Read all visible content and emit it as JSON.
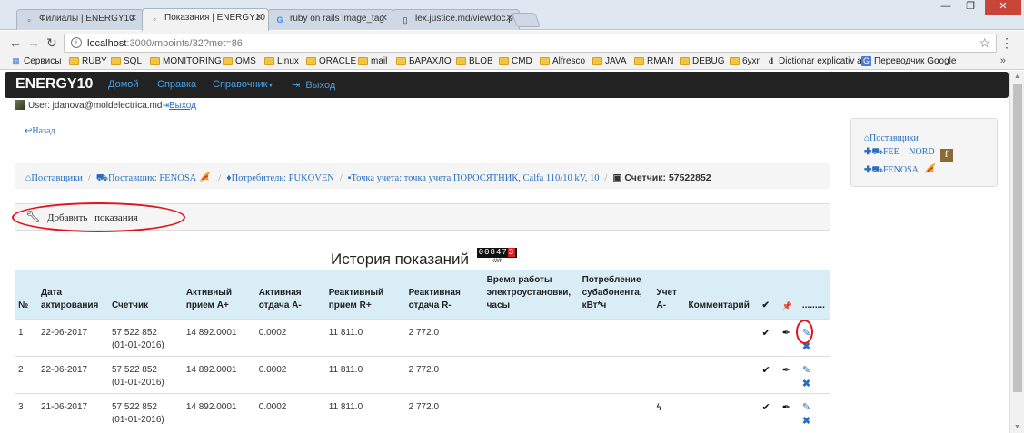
{
  "browser": {
    "tabs": [
      {
        "title": "Филиалы | ENERGY10",
        "favicon": "page-icon"
      },
      {
        "title": "Показания | ENERGY10",
        "favicon": "page-icon"
      },
      {
        "title": "ruby on rails image_tag",
        "favicon": "google-icon"
      },
      {
        "title": "lex.justice.md/viewdoc.p",
        "favicon": "document-icon"
      }
    ],
    "window_controls": {
      "minimize": "—",
      "maximize": "❐",
      "close": "✕"
    },
    "url_host": "localhost",
    "url_rest": ":3000/mpoints/32?met=86",
    "bookmarks": [
      {
        "label": "Сервисы",
        "icon": "apps-icon"
      },
      {
        "label": "RUBY",
        "icon": "folder-icon"
      },
      {
        "label": "SQL",
        "icon": "folder-icon"
      },
      {
        "label": "MONITORING",
        "icon": "folder-icon"
      },
      {
        "label": "OMS",
        "icon": "folder-icon"
      },
      {
        "label": "Linux",
        "icon": "folder-icon"
      },
      {
        "label": "ORACLE",
        "icon": "folder-icon"
      },
      {
        "label": "mail",
        "icon": "folder-icon"
      },
      {
        "label": "БАРАХЛО",
        "icon": "folder-icon"
      },
      {
        "label": "BLOB",
        "icon": "folder-icon"
      },
      {
        "label": "CMD",
        "icon": "folder-icon"
      },
      {
        "label": "Alfresco",
        "icon": "folder-icon"
      },
      {
        "label": "JAVA",
        "icon": "folder-icon"
      },
      {
        "label": "RMAN",
        "icon": "folder-icon"
      },
      {
        "label": "DEBUG",
        "icon": "folder-icon"
      },
      {
        "label": "6yxr",
        "icon": "folder-icon"
      },
      {
        "label": "Dictionar explicativ al",
        "icon": "dex-icon"
      },
      {
        "label": "Переводчик Google",
        "icon": "translate-icon"
      }
    ],
    "bookmarks_more": "»"
  },
  "navbar": {
    "brand": "ENERGY10",
    "home": "Домой",
    "help": "Справка",
    "reference": "Справочник",
    "logout": "Выход"
  },
  "user": {
    "label": "User: jdanova@moldelectrica.md",
    "logout": "Выход"
  },
  "back": "Назад",
  "breadcrumbs": {
    "suppliers": "Поставщики",
    "supplier": "Поставщик: FENOSA",
    "consumer": "Потребитель: PUKOVEN",
    "point": "Точка учета: точка учета ПОРОСЯТНИК, Calfa 110/10 kV, 10",
    "meter": "Счетчик: 57522852"
  },
  "add_readings": "Добавить показания",
  "history": {
    "title": "История показаний",
    "counter_digits": "00847",
    "counter_last": "3",
    "counter_unit": "kWh"
  },
  "table": {
    "headers": [
      "№",
      "Дата актирования",
      "Счетчик",
      "Активный прием А+",
      "Активная отдача А-",
      "Реактивный прием R+",
      "Реактивная отдача R-",
      "Время работы электроустановки, часы",
      "Потребление субабонента, кВт*ч",
      "Учет А-",
      "Комментарий",
      "✔",
      "📌",
      "........."
    ],
    "rows": [
      {
        "n": "1",
        "date": "22-06-2017",
        "meter": "57 522 852",
        "meter_date": "(01-01-2016)",
        "a_plus": "14 892.0001",
        "a_minus": "0.0002",
        "r_plus": "11 811.0",
        "r_minus": "2 772.0",
        "hours": "",
        "sub": "",
        "account": "",
        "comment": ""
      },
      {
        "n": "2",
        "date": "22-06-2017",
        "meter": "57 522 852",
        "meter_date": "(01-01-2016)",
        "a_plus": "14 892.0001",
        "a_minus": "0.0002",
        "r_plus": "11 811.0",
        "r_minus": "2 772.0",
        "hours": "",
        "sub": "",
        "account": "",
        "comment": ""
      },
      {
        "n": "3",
        "date": "21-06-2017",
        "meter": "57 522 852",
        "meter_date": "(01-01-2016)",
        "a_plus": "14 892.0001",
        "a_minus": "0.0002",
        "r_plus": "11 811.0",
        "r_minus": "2 772.0",
        "hours": "",
        "sub": "",
        "account": "bolt-icon",
        "comment": ""
      }
    ]
  },
  "sidebar": {
    "title": "Поставщики",
    "items": [
      "FEE NORD",
      "FENOSA"
    ]
  },
  "colors": {
    "link": "#2a6fbf",
    "navbar": "#222222",
    "highlight": "#e0141c",
    "table_header": "#d9edf7"
  }
}
